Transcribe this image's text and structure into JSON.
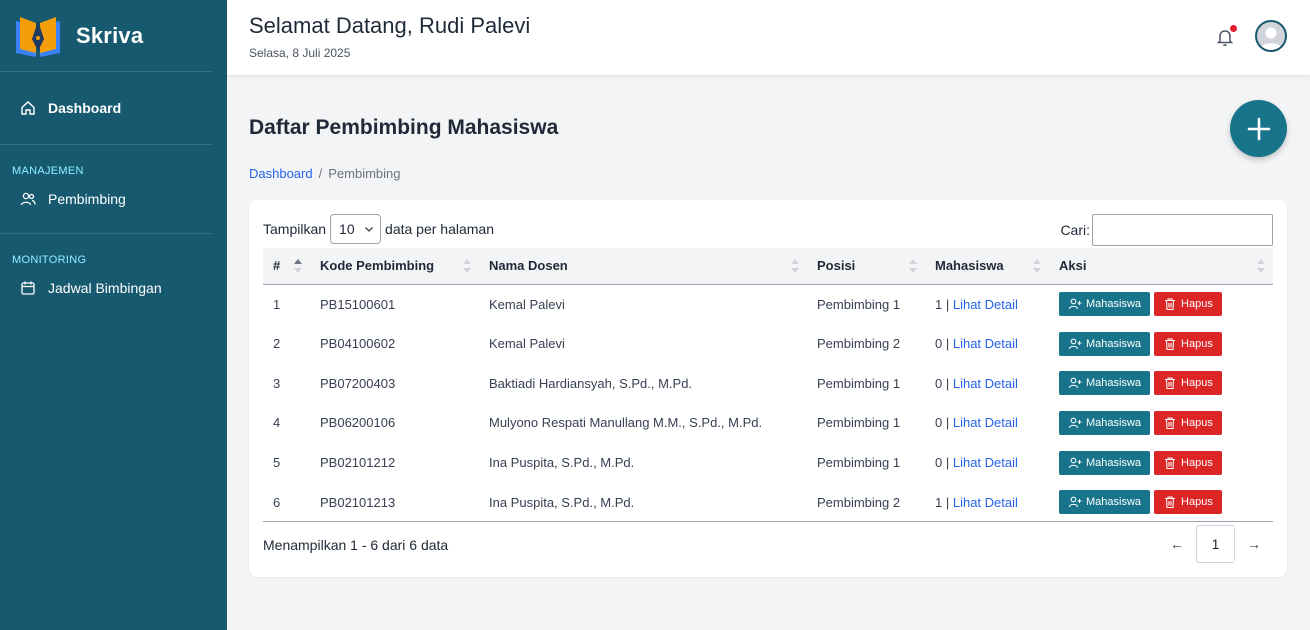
{
  "app": {
    "name": "Skriva"
  },
  "sidebar": {
    "dashboard_label": "Dashboard",
    "section_management": "MANAJEMEN",
    "pembimbing_label": "Pembimbing",
    "section_monitoring": "MONITORING",
    "jadwal_label": "Jadwal Bimbingan"
  },
  "header": {
    "greeting": "Selamat Datang, Rudi Palevi",
    "date": "Selasa, 8 Juli 2025"
  },
  "page": {
    "title": "Daftar Pembimbing Mahasiswa",
    "breadcrumb_home": "Dashboard",
    "breadcrumb_sep": "/",
    "breadcrumb_current": "Pembimbing"
  },
  "table_controls": {
    "show_prefix": "Tampilkan",
    "per_page_value": "10",
    "show_suffix": "data per halaman",
    "search_label": "Cari:",
    "search_value": ""
  },
  "table": {
    "headers": [
      "#",
      "Kode Pembimbing",
      "Nama Dosen",
      "Posisi",
      "Mahasiswa",
      "Aksi"
    ],
    "detail_link": "Lihat Detail",
    "btn_mahasiswa": "Mahasiswa",
    "btn_hapus": "Hapus",
    "rows": [
      {
        "no": "1",
        "kode": "PB15100601",
        "nama": "Kemal Palevi",
        "posisi": "Pembimbing 1",
        "mahasiswa": "1 |"
      },
      {
        "no": "2",
        "kode": "PB04100602",
        "nama": "Kemal Palevi",
        "posisi": "Pembimbing 2",
        "mahasiswa": "0 |"
      },
      {
        "no": "3",
        "kode": "PB07200403",
        "nama": "Baktiadi Hardiansyah, S.Pd., M.Pd.",
        "posisi": "Pembimbing 1",
        "mahasiswa": "0 |"
      },
      {
        "no": "4",
        "kode": "PB06200106",
        "nama": "Mulyono Respati Manullang M.M., S.Pd., M.Pd.",
        "posisi": "Pembimbing 1",
        "mahasiswa": "0 |"
      },
      {
        "no": "5",
        "kode": "PB02101212",
        "nama": "Ina Puspita, S.Pd., M.Pd.",
        "posisi": "Pembimbing 1",
        "mahasiswa": "0 |"
      },
      {
        "no": "6",
        "kode": "PB02101213",
        "nama": "Ina Puspita, S.Pd., M.Pd.",
        "posisi": "Pembimbing 2",
        "mahasiswa": "1 |"
      }
    ]
  },
  "footer": {
    "info": "Menampilkan 1 - 6 dari 6 data",
    "prev": "←",
    "page": "1",
    "next": "→"
  },
  "colors": {
    "sidebar": "#17596f",
    "primary": "#17748a",
    "danger": "#dc2626",
    "link": "#2563eb"
  }
}
